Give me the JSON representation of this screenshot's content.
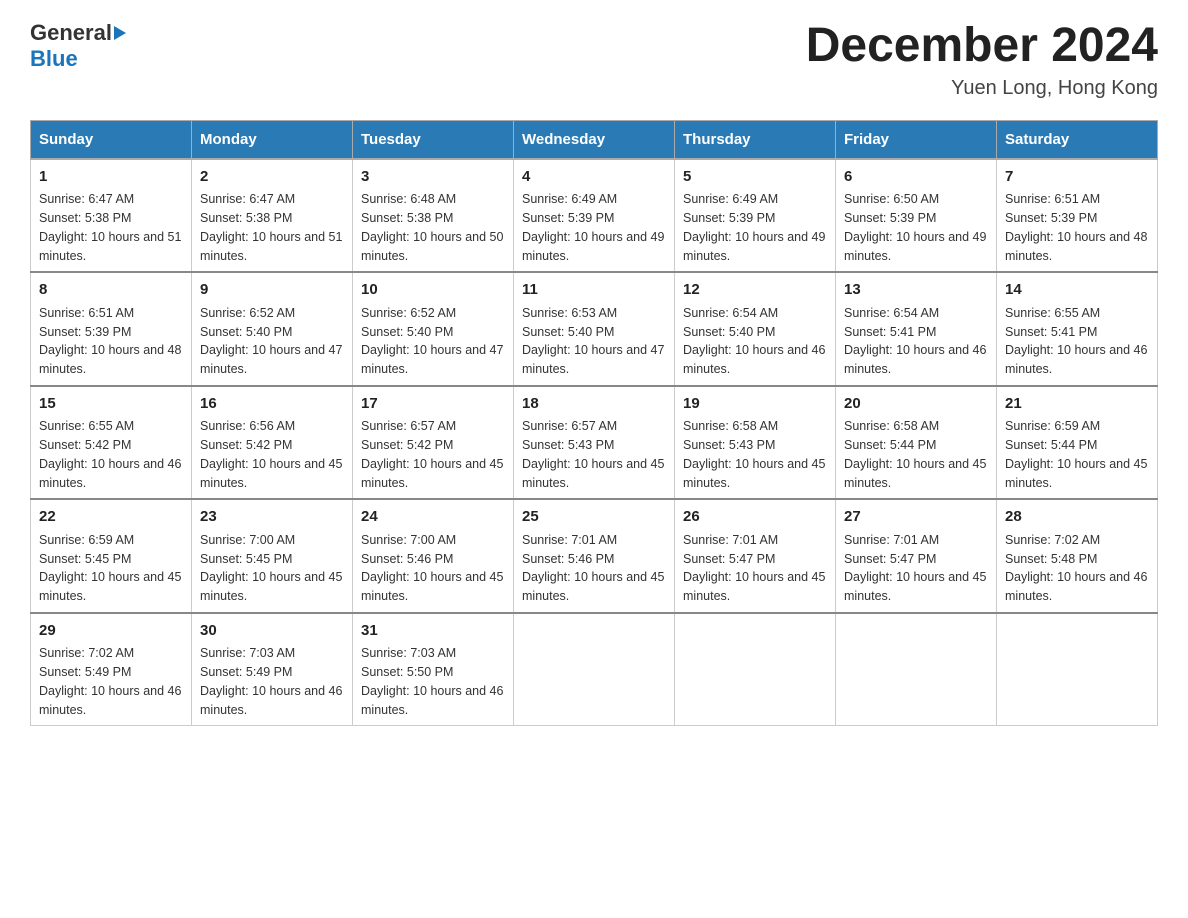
{
  "header": {
    "logo": {
      "general": "General",
      "blue": "Blue"
    },
    "title": "December 2024",
    "location": "Yuen Long, Hong Kong"
  },
  "calendar": {
    "days_of_week": [
      "Sunday",
      "Monday",
      "Tuesday",
      "Wednesday",
      "Thursday",
      "Friday",
      "Saturday"
    ],
    "weeks": [
      [
        {
          "day": "1",
          "sunrise": "Sunrise: 6:47 AM",
          "sunset": "Sunset: 5:38 PM",
          "daylight": "Daylight: 10 hours and 51 minutes."
        },
        {
          "day": "2",
          "sunrise": "Sunrise: 6:47 AM",
          "sunset": "Sunset: 5:38 PM",
          "daylight": "Daylight: 10 hours and 51 minutes."
        },
        {
          "day": "3",
          "sunrise": "Sunrise: 6:48 AM",
          "sunset": "Sunset: 5:38 PM",
          "daylight": "Daylight: 10 hours and 50 minutes."
        },
        {
          "day": "4",
          "sunrise": "Sunrise: 6:49 AM",
          "sunset": "Sunset: 5:39 PM",
          "daylight": "Daylight: 10 hours and 49 minutes."
        },
        {
          "day": "5",
          "sunrise": "Sunrise: 6:49 AM",
          "sunset": "Sunset: 5:39 PM",
          "daylight": "Daylight: 10 hours and 49 minutes."
        },
        {
          "day": "6",
          "sunrise": "Sunrise: 6:50 AM",
          "sunset": "Sunset: 5:39 PM",
          "daylight": "Daylight: 10 hours and 49 minutes."
        },
        {
          "day": "7",
          "sunrise": "Sunrise: 6:51 AM",
          "sunset": "Sunset: 5:39 PM",
          "daylight": "Daylight: 10 hours and 48 minutes."
        }
      ],
      [
        {
          "day": "8",
          "sunrise": "Sunrise: 6:51 AM",
          "sunset": "Sunset: 5:39 PM",
          "daylight": "Daylight: 10 hours and 48 minutes."
        },
        {
          "day": "9",
          "sunrise": "Sunrise: 6:52 AM",
          "sunset": "Sunset: 5:40 PM",
          "daylight": "Daylight: 10 hours and 47 minutes."
        },
        {
          "day": "10",
          "sunrise": "Sunrise: 6:52 AM",
          "sunset": "Sunset: 5:40 PM",
          "daylight": "Daylight: 10 hours and 47 minutes."
        },
        {
          "day": "11",
          "sunrise": "Sunrise: 6:53 AM",
          "sunset": "Sunset: 5:40 PM",
          "daylight": "Daylight: 10 hours and 47 minutes."
        },
        {
          "day": "12",
          "sunrise": "Sunrise: 6:54 AM",
          "sunset": "Sunset: 5:40 PM",
          "daylight": "Daylight: 10 hours and 46 minutes."
        },
        {
          "day": "13",
          "sunrise": "Sunrise: 6:54 AM",
          "sunset": "Sunset: 5:41 PM",
          "daylight": "Daylight: 10 hours and 46 minutes."
        },
        {
          "day": "14",
          "sunrise": "Sunrise: 6:55 AM",
          "sunset": "Sunset: 5:41 PM",
          "daylight": "Daylight: 10 hours and 46 minutes."
        }
      ],
      [
        {
          "day": "15",
          "sunrise": "Sunrise: 6:55 AM",
          "sunset": "Sunset: 5:42 PM",
          "daylight": "Daylight: 10 hours and 46 minutes."
        },
        {
          "day": "16",
          "sunrise": "Sunrise: 6:56 AM",
          "sunset": "Sunset: 5:42 PM",
          "daylight": "Daylight: 10 hours and 45 minutes."
        },
        {
          "day": "17",
          "sunrise": "Sunrise: 6:57 AM",
          "sunset": "Sunset: 5:42 PM",
          "daylight": "Daylight: 10 hours and 45 minutes."
        },
        {
          "day": "18",
          "sunrise": "Sunrise: 6:57 AM",
          "sunset": "Sunset: 5:43 PM",
          "daylight": "Daylight: 10 hours and 45 minutes."
        },
        {
          "day": "19",
          "sunrise": "Sunrise: 6:58 AM",
          "sunset": "Sunset: 5:43 PM",
          "daylight": "Daylight: 10 hours and 45 minutes."
        },
        {
          "day": "20",
          "sunrise": "Sunrise: 6:58 AM",
          "sunset": "Sunset: 5:44 PM",
          "daylight": "Daylight: 10 hours and 45 minutes."
        },
        {
          "day": "21",
          "sunrise": "Sunrise: 6:59 AM",
          "sunset": "Sunset: 5:44 PM",
          "daylight": "Daylight: 10 hours and 45 minutes."
        }
      ],
      [
        {
          "day": "22",
          "sunrise": "Sunrise: 6:59 AM",
          "sunset": "Sunset: 5:45 PM",
          "daylight": "Daylight: 10 hours and 45 minutes."
        },
        {
          "day": "23",
          "sunrise": "Sunrise: 7:00 AM",
          "sunset": "Sunset: 5:45 PM",
          "daylight": "Daylight: 10 hours and 45 minutes."
        },
        {
          "day": "24",
          "sunrise": "Sunrise: 7:00 AM",
          "sunset": "Sunset: 5:46 PM",
          "daylight": "Daylight: 10 hours and 45 minutes."
        },
        {
          "day": "25",
          "sunrise": "Sunrise: 7:01 AM",
          "sunset": "Sunset: 5:46 PM",
          "daylight": "Daylight: 10 hours and 45 minutes."
        },
        {
          "day": "26",
          "sunrise": "Sunrise: 7:01 AM",
          "sunset": "Sunset: 5:47 PM",
          "daylight": "Daylight: 10 hours and 45 minutes."
        },
        {
          "day": "27",
          "sunrise": "Sunrise: 7:01 AM",
          "sunset": "Sunset: 5:47 PM",
          "daylight": "Daylight: 10 hours and 45 minutes."
        },
        {
          "day": "28",
          "sunrise": "Sunrise: 7:02 AM",
          "sunset": "Sunset: 5:48 PM",
          "daylight": "Daylight: 10 hours and 46 minutes."
        }
      ],
      [
        {
          "day": "29",
          "sunrise": "Sunrise: 7:02 AM",
          "sunset": "Sunset: 5:49 PM",
          "daylight": "Daylight: 10 hours and 46 minutes."
        },
        {
          "day": "30",
          "sunrise": "Sunrise: 7:03 AM",
          "sunset": "Sunset: 5:49 PM",
          "daylight": "Daylight: 10 hours and 46 minutes."
        },
        {
          "day": "31",
          "sunrise": "Sunrise: 7:03 AM",
          "sunset": "Sunset: 5:50 PM",
          "daylight": "Daylight: 10 hours and 46 minutes."
        },
        null,
        null,
        null,
        null
      ]
    ]
  }
}
